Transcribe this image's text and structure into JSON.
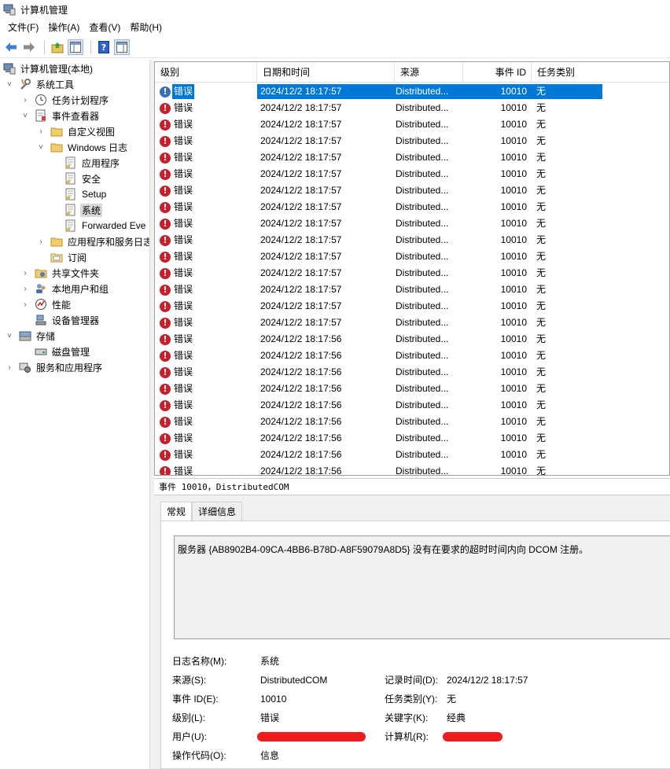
{
  "window": {
    "title": "计算机管理"
  },
  "menu": [
    {
      "label": "文件(F)"
    },
    {
      "label": "操作(A)"
    },
    {
      "label": "查看(V)"
    },
    {
      "label": "帮助(H)"
    }
  ],
  "tree": [
    {
      "label": "计算机管理(本地)",
      "level": 0,
      "chevron": "",
      "icon": "computer-management-icon"
    },
    {
      "label": "系统工具",
      "level": 1,
      "chevron": "˅",
      "icon": "tools-icon"
    },
    {
      "label": "任务计划程序",
      "level": 2,
      "chevron": "›",
      "icon": "clock-icon"
    },
    {
      "label": "事件查看器",
      "level": 2,
      "chevron": "˅",
      "icon": "event-viewer-icon"
    },
    {
      "label": "自定义视图",
      "level": 3,
      "chevron": "›",
      "icon": "folder-icon"
    },
    {
      "label": "Windows 日志",
      "level": 3,
      "chevron": "˅",
      "icon": "folder-icon"
    },
    {
      "label": "应用程序",
      "level": 4,
      "chevron": "",
      "icon": "log-icon"
    },
    {
      "label": "安全",
      "level": 4,
      "chevron": "",
      "icon": "log-icon"
    },
    {
      "label": "Setup",
      "level": 4,
      "chevron": "",
      "icon": "log-icon"
    },
    {
      "label": "系统",
      "level": 4,
      "chevron": "",
      "icon": "log-icon",
      "selected": true
    },
    {
      "label": "Forwarded Eve",
      "level": 4,
      "chevron": "",
      "icon": "log-icon"
    },
    {
      "label": "应用程序和服务日志",
      "level": 3,
      "chevron": "›",
      "icon": "folder-icon"
    },
    {
      "label": "订阅",
      "level": 3,
      "chevron": "",
      "icon": "subscription-icon"
    },
    {
      "label": "共享文件夹",
      "level": 2,
      "chevron": "›",
      "icon": "shared-folder-icon"
    },
    {
      "label": "本地用户和组",
      "level": 2,
      "chevron": "›",
      "icon": "users-icon"
    },
    {
      "label": "性能",
      "level": 2,
      "chevron": "›",
      "icon": "performance-icon"
    },
    {
      "label": "设备管理器",
      "level": 2,
      "chevron": "",
      "icon": "device-manager-icon"
    },
    {
      "label": "存储",
      "level": 1,
      "chevron": "˅",
      "icon": "storage-icon"
    },
    {
      "label": "磁盘管理",
      "level": 2,
      "chevron": "",
      "icon": "disk-icon"
    },
    {
      "label": "服务和应用程序",
      "level": 1,
      "chevron": "›",
      "icon": "services-icon"
    }
  ],
  "list": {
    "columns": [
      "级别",
      "日期和时间",
      "来源",
      "事件 ID",
      "任务类别"
    ],
    "rows": [
      {
        "level": "错误",
        "date": "2024/12/2 18:17:57",
        "source": "Distributed...",
        "id": "10010",
        "task": "无"
      },
      {
        "level": "错误",
        "date": "2024/12/2 18:17:57",
        "source": "Distributed...",
        "id": "10010",
        "task": "无"
      },
      {
        "level": "错误",
        "date": "2024/12/2 18:17:57",
        "source": "Distributed...",
        "id": "10010",
        "task": "无"
      },
      {
        "level": "错误",
        "date": "2024/12/2 18:17:57",
        "source": "Distributed...",
        "id": "10010",
        "task": "无"
      },
      {
        "level": "错误",
        "date": "2024/12/2 18:17:57",
        "source": "Distributed...",
        "id": "10010",
        "task": "无"
      },
      {
        "level": "错误",
        "date": "2024/12/2 18:17:57",
        "source": "Distributed...",
        "id": "10010",
        "task": "无"
      },
      {
        "level": "错误",
        "date": "2024/12/2 18:17:57",
        "source": "Distributed...",
        "id": "10010",
        "task": "无"
      },
      {
        "level": "错误",
        "date": "2024/12/2 18:17:57",
        "source": "Distributed...",
        "id": "10010",
        "task": "无"
      },
      {
        "level": "错误",
        "date": "2024/12/2 18:17:57",
        "source": "Distributed...",
        "id": "10010",
        "task": "无"
      },
      {
        "level": "错误",
        "date": "2024/12/2 18:17:57",
        "source": "Distributed...",
        "id": "10010",
        "task": "无"
      },
      {
        "level": "错误",
        "date": "2024/12/2 18:17:57",
        "source": "Distributed...",
        "id": "10010",
        "task": "无"
      },
      {
        "level": "错误",
        "date": "2024/12/2 18:17:57",
        "source": "Distributed...",
        "id": "10010",
        "task": "无"
      },
      {
        "level": "错误",
        "date": "2024/12/2 18:17:57",
        "source": "Distributed...",
        "id": "10010",
        "task": "无"
      },
      {
        "level": "错误",
        "date": "2024/12/2 18:17:57",
        "source": "Distributed...",
        "id": "10010",
        "task": "无"
      },
      {
        "level": "错误",
        "date": "2024/12/2 18:17:57",
        "source": "Distributed...",
        "id": "10010",
        "task": "无"
      },
      {
        "level": "错误",
        "date": "2024/12/2 18:17:56",
        "source": "Distributed...",
        "id": "10010",
        "task": "无"
      },
      {
        "level": "错误",
        "date": "2024/12/2 18:17:56",
        "source": "Distributed...",
        "id": "10010",
        "task": "无"
      },
      {
        "level": "错误",
        "date": "2024/12/2 18:17:56",
        "source": "Distributed...",
        "id": "10010",
        "task": "无"
      },
      {
        "level": "错误",
        "date": "2024/12/2 18:17:56",
        "source": "Distributed...",
        "id": "10010",
        "task": "无"
      },
      {
        "level": "错误",
        "date": "2024/12/2 18:17:56",
        "source": "Distributed...",
        "id": "10010",
        "task": "无"
      },
      {
        "level": "错误",
        "date": "2024/12/2 18:17:56",
        "source": "Distributed...",
        "id": "10010",
        "task": "无"
      },
      {
        "level": "错误",
        "date": "2024/12/2 18:17:56",
        "source": "Distributed...",
        "id": "10010",
        "task": "无"
      },
      {
        "level": "错误",
        "date": "2024/12/2 18:17:56",
        "source": "Distributed...",
        "id": "10010",
        "task": "无"
      },
      {
        "level": "错误",
        "date": "2024/12/2 18:17:56",
        "source": "Distributed...",
        "id": "10010",
        "task": "无"
      }
    ]
  },
  "detail": {
    "header": "事件 10010，DistributedCOM",
    "tabs": [
      "常规",
      "详细信息"
    ],
    "message": "服务器 {AB8902B4-09CA-4BB6-B78D-A8F59079A8D5} 没有在要求的超时时间内向 DCOM 注册。",
    "props": {
      "log_name_label": "日志名称(M):",
      "log_name": "系统",
      "source_label": "来源(S):",
      "source": "DistributedCOM",
      "logged_label": "记录时间(D):",
      "logged": "2024/12/2 18:17:57",
      "event_id_label": "事件 ID(E):",
      "event_id": "10010",
      "task_label": "任务类别(Y):",
      "task": "无",
      "level_label": "级别(L):",
      "level": "错误",
      "keywords_label": "关键字(K):",
      "keywords": "经典",
      "user_label": "用户(U):",
      "computer_label": "计算机(R):",
      "opcode_label": "操作代码(O):",
      "opcode": "信息"
    }
  },
  "colors": {
    "selection": "#0078d7",
    "error": "#c8202a",
    "redaction": "#ee1c1c"
  }
}
